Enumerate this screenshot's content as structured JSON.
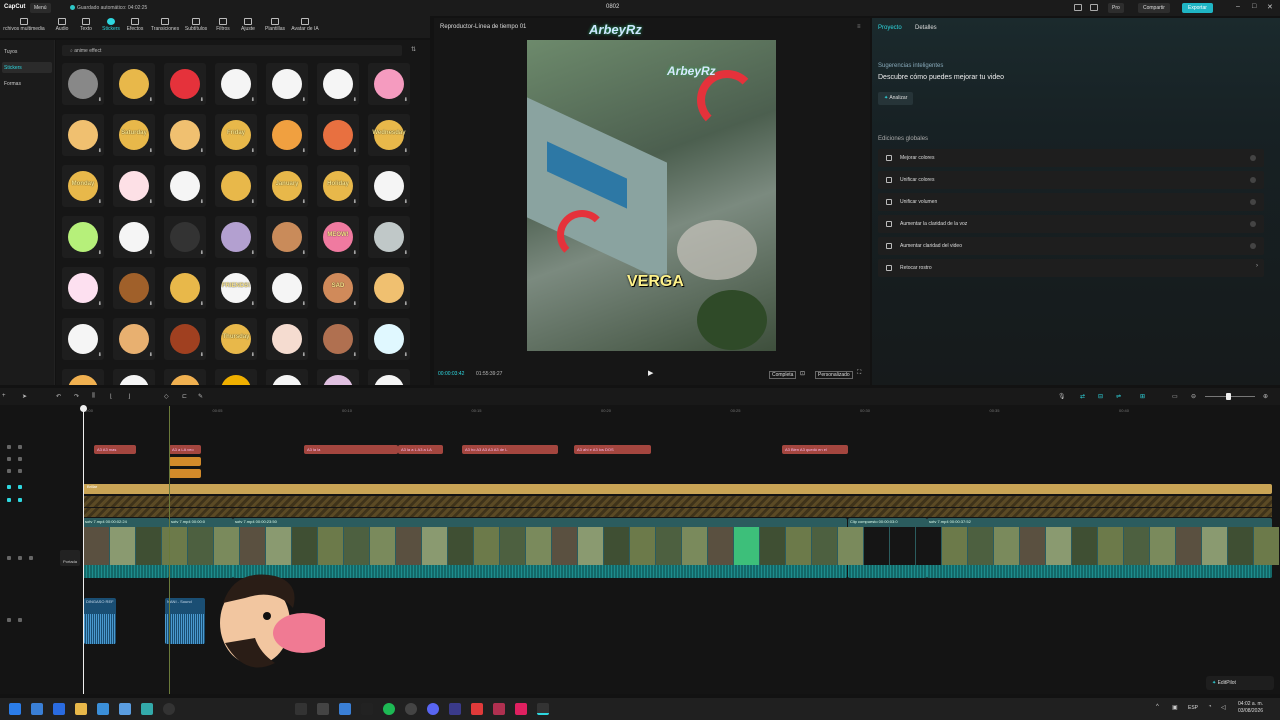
{
  "titlebar": {
    "logo": "CapCut",
    "menu": "Menú",
    "autosave": "Guardado automático: 04:02:25",
    "project_name": "0802",
    "pro": "Pro",
    "share": "Compartir",
    "export": "Exportar"
  },
  "toolbar": {
    "tools": [
      {
        "label": "rchivos multimedia",
        "icon": "media-icon"
      },
      {
        "label": "Audio",
        "icon": "audio-icon"
      },
      {
        "label": "Texto",
        "icon": "text-icon"
      },
      {
        "label": "Stickers",
        "icon": "stickers-icon"
      },
      {
        "label": "Efectos",
        "icon": "effects-icon"
      },
      {
        "label": "Transiciones",
        "icon": "transitions-icon"
      },
      {
        "label": "Subtítulos",
        "icon": "subtitles-icon"
      },
      {
        "label": "Filtros",
        "icon": "filters-icon"
      },
      {
        "label": "Ajuste",
        "icon": "adjust-icon"
      },
      {
        "label": "Plantillas",
        "icon": "templates-icon"
      },
      {
        "label": "Avatar de IA",
        "icon": "ai-avatar-icon"
      }
    ]
  },
  "leftnav": {
    "items": [
      {
        "label": "Tuyos"
      },
      {
        "label": "Stickers"
      },
      {
        "label": "Formas"
      }
    ]
  },
  "stickers": {
    "search_value": "anime effect",
    "texts": [
      "Saturday",
      "Friday",
      "Wednesday",
      "Monday",
      "January",
      "Holiday",
      "MEOW!",
      "SAD",
      "FRIENDS!",
      "Thursday"
    ]
  },
  "player": {
    "title": "Reproductor-Línea de tiempo 01",
    "watermark": "ArbeyRz",
    "caption": "VERGA",
    "time_current": "00:00:03:42",
    "time_total": "01:55:39:27",
    "btn_complete": "Completa",
    "btn_custom": "Personalizado"
  },
  "rightpanel": {
    "tab_project": "Proyecto",
    "tab_details": "Detalles",
    "smart_label": "Sugerencias inteligentes",
    "smart_desc": "Descubre cómo puedes mejorar tu video",
    "analyze": "Analizar",
    "global_label": "Ediciones globales",
    "global_items": [
      {
        "label": "Mejorar colores"
      },
      {
        "label": "Unificar colores"
      },
      {
        "label": "Unificar volumen"
      },
      {
        "label": "Aumentar la claridad de la voz"
      },
      {
        "label": "Aumentar claridad del video"
      },
      {
        "label": "Retocar rostro"
      }
    ]
  },
  "timeline": {
    "ruler": [
      "00:00",
      "00:05",
      "00:10",
      "00:15",
      "00:20",
      "00:25",
      "00:30",
      "00:35",
      "00:40"
    ],
    "text_clips": [
      {
        "label": "A3 A3 mas"
      },
      {
        "label": "A3 a LA veo"
      },
      {
        "label": "A3 la la"
      },
      {
        "label": "A3 la a L A3 a LA"
      },
      {
        "label": "A3 ho A3 A3 A3 A3 de L"
      },
      {
        "label": "A3 ahí e A3 los DOS"
      },
      {
        "label": "A3 Bien A3 quedó en el"
      }
    ],
    "yellow_track_label": "Brillar",
    "video_clips": [
      {
        "label": "sotv 7.mp4  00:00:02:24"
      },
      {
        "label": "sotv 7.mp4  00:00:0"
      },
      {
        "label": "sotv 7.mp4  00:00:23:50"
      },
      {
        "label": "Clip compuesto  00:00:03:0"
      },
      {
        "label": "sotv 7.mp4  00:00:37:52"
      }
    ],
    "cover_label": "Portada",
    "audio_clips": [
      {
        "label": "DINGASO REF"
      },
      {
        "label": "NANI - Sound"
      }
    ]
  },
  "taskbar": {
    "lang": "ESP",
    "time": "04:02 a. m.",
    "date": "03/08/2026",
    "editpilot": "EditPilot"
  }
}
